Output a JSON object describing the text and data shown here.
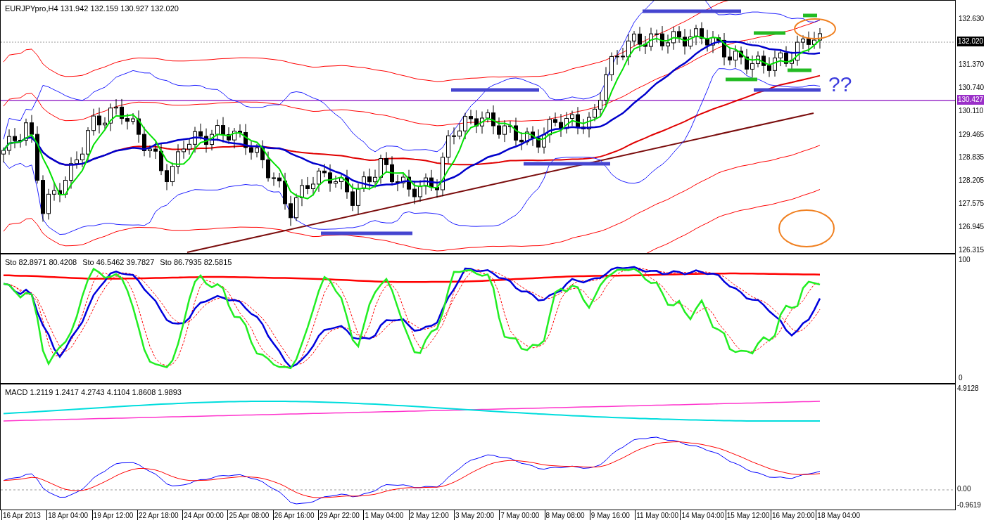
{
  "chart": {
    "symbol": "EURJPYpro,H4",
    "ohlc": "131.942 132.159 130.927 132.020",
    "annotation": "??",
    "current_price": "132.020",
    "level_price": "130.427",
    "price_ticks": [
      "132.630",
      "131.370",
      "130.740",
      "130.110",
      "129.465",
      "128.835",
      "128.205",
      "127.575",
      "126.945",
      "126.315"
    ]
  },
  "stochastic": {
    "legend": [
      "Sto 82.8971 80.4208",
      "Sto 46.5462 39.7827",
      "Sto 86.7935 82.5815"
    ],
    "scale_max": "100",
    "scale_min": "0"
  },
  "macd": {
    "legend": "MACD 1.2119 1.2417 4.2743 4.1104 1.8608 1.9893",
    "scale_max": "4.9128",
    "zero": "0.00",
    "scale_min": "-0.9619"
  },
  "time_axis": [
    "16 Apr 2013",
    "18 Apr 04:00",
    "19 Apr 12:00",
    "22 Apr 18:00",
    "24 Apr 00:00",
    "25 Apr 08:00",
    "26 Apr 16:00",
    "29 Apr 22:00",
    "1 May 04:00",
    "2 May 12:00",
    "3 May 20:00",
    "7 May 00:00",
    "8 May 08:00",
    "9 May 16:00",
    "11 May 00:00",
    "14 May 04:00",
    "15 May 12:00",
    "16 May 20:00",
    "18 May 04:00"
  ]
}
